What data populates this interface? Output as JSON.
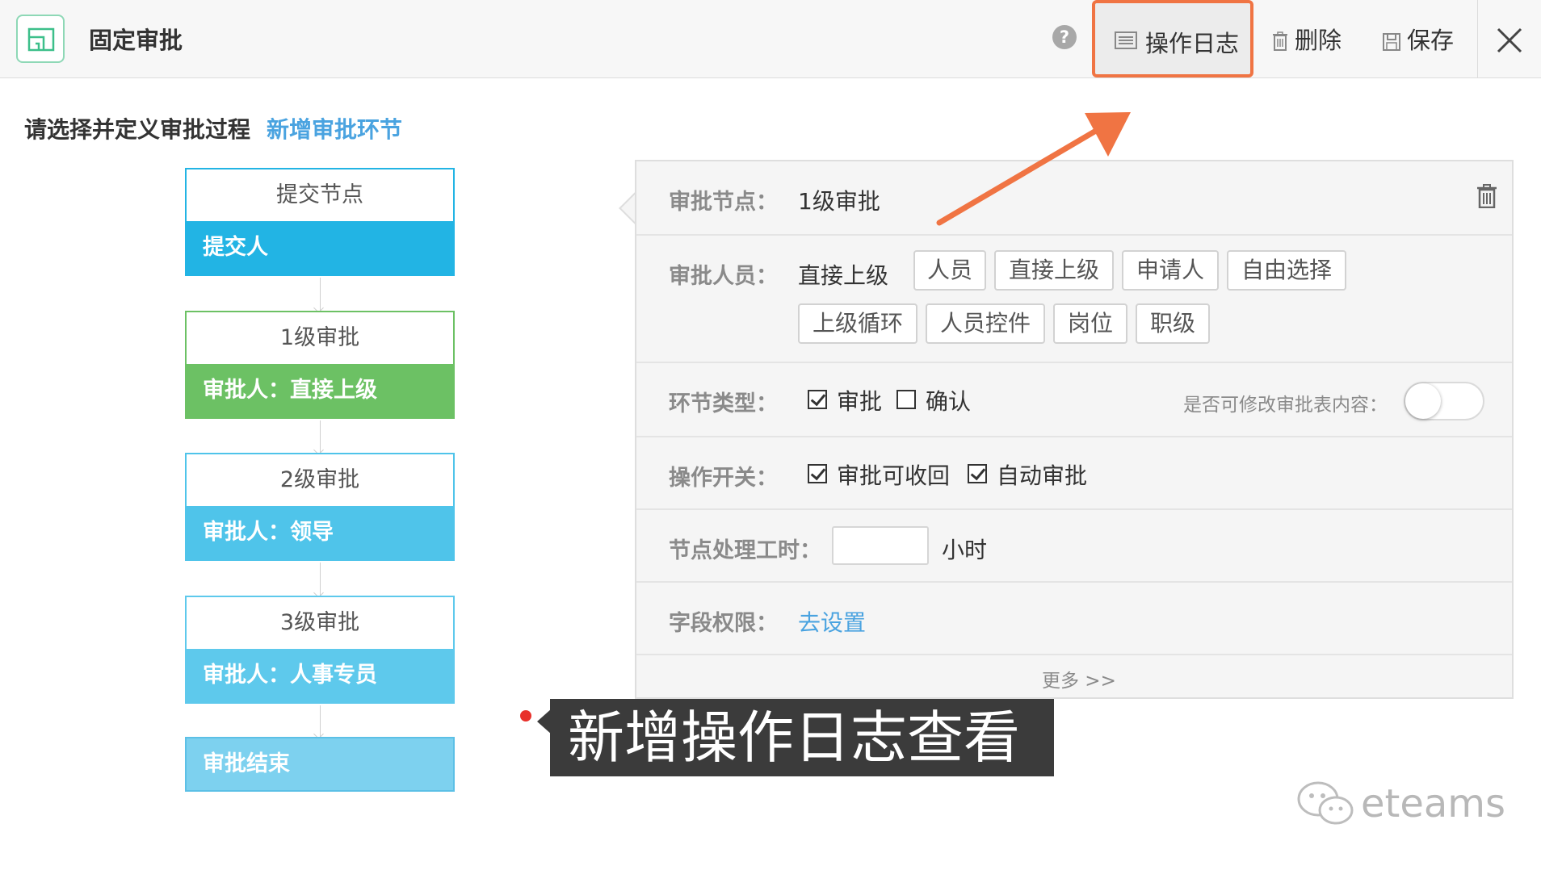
{
  "header": {
    "title": "固定审批",
    "help_glyph": "?",
    "log_label": "操作日志",
    "delete_label": "删除",
    "save_label": "保存"
  },
  "flow": {
    "instruction": "请选择并定义审批过程",
    "add_link": "新增审批环节",
    "nodes": [
      {
        "title": "提交节点",
        "body": "提交人",
        "color": "#22b4e4"
      },
      {
        "title": "1级审批",
        "body": "审批人：直接上级",
        "color": "#6cc164"
      },
      {
        "title": "2级审批",
        "body": "审批人：领导",
        "color": "#4fc4ea"
      },
      {
        "title": "3级审批",
        "body": "审批人：人事专员",
        "color": "#5ec9ec"
      }
    ],
    "end": "审批结束"
  },
  "detail": {
    "node_label": "审批节点：",
    "node_value": "1级审批",
    "approver_label": "审批人员：",
    "approver_value": "直接上级",
    "approver_tags": [
      "人员",
      "直接上级",
      "申请人",
      "自由选择",
      "上级循环",
      "人员控件",
      "岗位",
      "职级"
    ],
    "type_label": "环节类型：",
    "type_options": [
      {
        "label": "审批",
        "checked": true
      },
      {
        "label": "确认",
        "checked": false
      }
    ],
    "editable_label": "是否可修改审批表内容：",
    "editable_on": false,
    "switch_label": "操作开关：",
    "switch_options": [
      {
        "label": "审批可收回",
        "checked": true
      },
      {
        "label": "自动审批",
        "checked": true
      }
    ],
    "hours_label": "节点处理工时：",
    "hours_value": "",
    "hours_unit": "小时",
    "field_label": "字段权限：",
    "field_link": "去设置",
    "more": "更多 >>"
  },
  "annotation": {
    "caption": "新增操作日志查看",
    "highlight_color": "#f07443"
  },
  "watermark": "eteams"
}
